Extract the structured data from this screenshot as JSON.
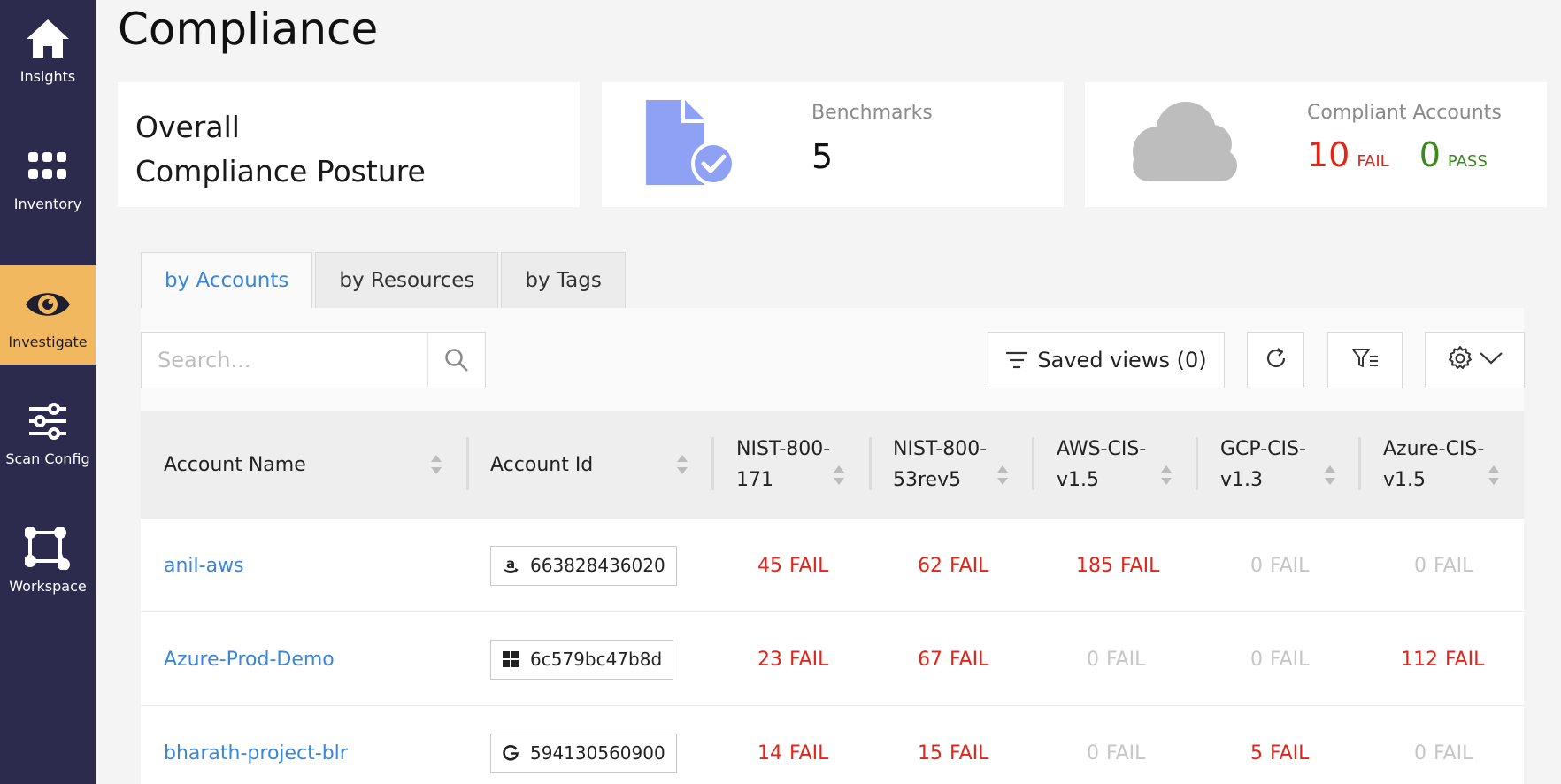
{
  "sidebar": {
    "items": [
      {
        "label": "Insights",
        "icon": "home-icon"
      },
      {
        "label": "Inventory",
        "icon": "grid-icon"
      },
      {
        "label": "Investigate",
        "icon": "eye-icon",
        "active": true
      },
      {
        "label": "Scan Config",
        "icon": "sliders-icon"
      },
      {
        "label": "Workspace",
        "icon": "workspace-icon"
      }
    ]
  },
  "page": {
    "title": "Compliance"
  },
  "cards": {
    "posture": {
      "line1": "Overall",
      "line2": "Compliance Posture"
    },
    "benchmarks": {
      "label": "Benchmarks",
      "value": "5"
    },
    "compliant_accounts": {
      "label": "Compliant Accounts",
      "fail_count": "10",
      "fail_label": "FAIL",
      "pass_count": "0",
      "pass_label": "PASS"
    }
  },
  "colors": {
    "accent": "#3a86d8",
    "fail": "#e0251b",
    "pass": "#3a8a1c",
    "sidebar": "#2d2b4d",
    "active_nav": "#f1b85f"
  },
  "tabs": [
    {
      "label": "by Accounts",
      "active": true
    },
    {
      "label": "by Resources"
    },
    {
      "label": "by Tags"
    }
  ],
  "toolbar": {
    "search_placeholder": "Search...",
    "saved_views_label": "Saved views (0)"
  },
  "table": {
    "columns": [
      {
        "line1": "Account Name",
        "line2": ""
      },
      {
        "line1": "Account Id",
        "line2": ""
      },
      {
        "line1": "NIST-800-",
        "line2": "171"
      },
      {
        "line1": "NIST-800-",
        "line2": "53rev5"
      },
      {
        "line1": "AWS-CIS-",
        "line2": "v1.5"
      },
      {
        "line1": "GCP-CIS-",
        "line2": "v1.3"
      },
      {
        "line1": "Azure-CIS-",
        "line2": "v1.5"
      }
    ],
    "rows": [
      {
        "name": "anil-aws",
        "provider": "aws-icon",
        "id": "663828436020",
        "values": [
          {
            "n": "45",
            "t": "FAIL"
          },
          {
            "n": "62",
            "t": "FAIL"
          },
          {
            "n": "185",
            "t": "FAIL"
          },
          {
            "n": "0",
            "t": "FAIL"
          },
          {
            "n": "0",
            "t": "FAIL"
          }
        ]
      },
      {
        "name": "Azure-Prod-Demo",
        "provider": "windows-icon",
        "id": "6c579bc47b8d",
        "values": [
          {
            "n": "23",
            "t": "FAIL"
          },
          {
            "n": "67",
            "t": "FAIL"
          },
          {
            "n": "0",
            "t": "FAIL"
          },
          {
            "n": "0",
            "t": "FAIL"
          },
          {
            "n": "112",
            "t": "FAIL"
          }
        ]
      },
      {
        "name": "bharath-project-blr",
        "provider": "google-icon",
        "id": "594130560900",
        "values": [
          {
            "n": "14",
            "t": "FAIL"
          },
          {
            "n": "15",
            "t": "FAIL"
          },
          {
            "n": "0",
            "t": "FAIL"
          },
          {
            "n": "5",
            "t": "FAIL"
          },
          {
            "n": "0",
            "t": "FAIL"
          }
        ]
      }
    ]
  }
}
